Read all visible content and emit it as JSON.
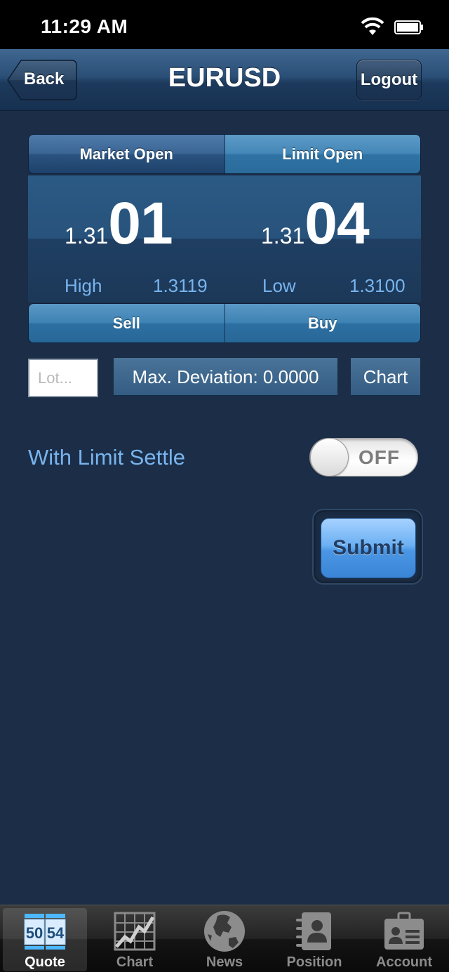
{
  "status_bar": {
    "time": "11:29 AM"
  },
  "navbar": {
    "back_label": "Back",
    "title": "EURUSD",
    "logout_label": "Logout"
  },
  "order_types": {
    "market_label": "Market Open",
    "limit_label": "Limit Open",
    "selected": "Limit Open"
  },
  "quote": {
    "sell": {
      "prefix": "1.31",
      "pips": "01"
    },
    "buy": {
      "prefix": "1.31",
      "pips": "04"
    },
    "high_label": "High",
    "high_value": "1.3119",
    "low_label": "Low",
    "low_value": "1.3100"
  },
  "actions": {
    "sell_label": "Sell",
    "buy_label": "Buy"
  },
  "lot": {
    "placeholder": "Lot...",
    "value": ""
  },
  "max_deviation": "Max. Deviation: 0.0000",
  "chart_button": "Chart",
  "limit_settle": {
    "label": "With Limit Settle",
    "state": "OFF"
  },
  "submit_label": "Submit",
  "tabs": [
    {
      "label": "Quote",
      "icon": "quote-icon",
      "icon_text_left": "50",
      "icon_text_right": "54",
      "active": true
    },
    {
      "label": "Chart",
      "icon": "chart-icon",
      "active": false
    },
    {
      "label": "News",
      "icon": "globe-icon",
      "active": false
    },
    {
      "label": "Position",
      "icon": "contact-book-icon",
      "active": false
    },
    {
      "label": "Account",
      "icon": "id-badge-icon",
      "active": false
    }
  ],
  "colors": {
    "background": "#1b2d47",
    "accent_text": "#78b4ee",
    "submit": "#4a96e4"
  }
}
